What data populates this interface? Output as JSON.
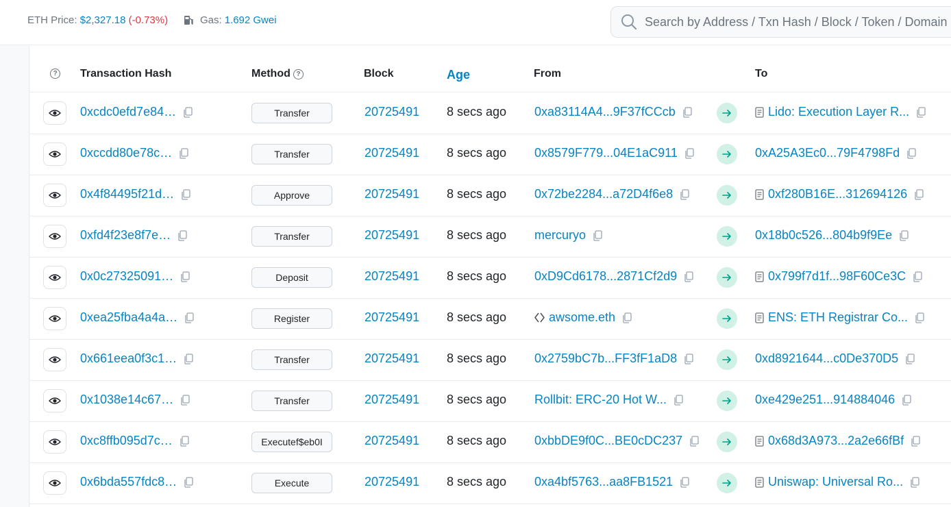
{
  "topbar": {
    "eth_price_label": "ETH Price:",
    "eth_price_value": "$2,327.18",
    "eth_price_change": "(-0.73%)",
    "gas_label": "Gas:",
    "gas_value": "1.692 Gwei",
    "search_placeholder": "Search by Address / Txn Hash / Block / Token / Domain Name"
  },
  "table": {
    "headers": {
      "txhash": "Transaction Hash",
      "method": "Method",
      "block": "Block",
      "age": "Age",
      "from": "From",
      "to": "To"
    },
    "rows": [
      {
        "hash": "0xcdc0efd7e84…",
        "method": "Transfer",
        "block": "20725491",
        "age": "8 secs ago",
        "from": "0xa83114A4...9F37fCCcb",
        "from_icon": "",
        "to": "Lido: Execution Layer R...",
        "to_icon": "contract"
      },
      {
        "hash": "0xccdd80e78c…",
        "method": "Transfer",
        "block": "20725491",
        "age": "8 secs ago",
        "from": "0x8579F779...04E1aC911",
        "from_icon": "",
        "to": "0xA25A3Ec0...79F4798Fd",
        "to_icon": ""
      },
      {
        "hash": "0x4f84495f21d…",
        "method": "Approve",
        "block": "20725491",
        "age": "8 secs ago",
        "from": "0x72be2284...a72D4f6e8",
        "from_icon": "",
        "to": "0xf280B16E...312694126",
        "to_icon": "contract"
      },
      {
        "hash": "0xfd4f23e8f7e…",
        "method": "Transfer",
        "block": "20725491",
        "age": "8 secs ago",
        "from": "mercuryo",
        "from_icon": "",
        "to": "0x18b0c526...804b9f9Ee",
        "to_icon": ""
      },
      {
        "hash": "0x0c27325091…",
        "method": "Deposit",
        "block": "20725491",
        "age": "8 secs ago",
        "from": "0xD9Cd6178...2871Cf2d9",
        "from_icon": "",
        "to": "0x799f7d1f...98F60Ce3C",
        "to_icon": "contract"
      },
      {
        "hash": "0xea25fba4a4a…",
        "method": "Register",
        "block": "20725491",
        "age": "8 secs ago",
        "from": "awsome.eth",
        "from_icon": "ens",
        "to": "ENS: ETH Registrar Co...",
        "to_icon": "contract"
      },
      {
        "hash": "0x661eea0f3c1…",
        "method": "Transfer",
        "block": "20725491",
        "age": "8 secs ago",
        "from": "0x2759bC7b...FF3fF1aD8",
        "from_icon": "",
        "to": "0xd8921644...c0De370D5",
        "to_icon": ""
      },
      {
        "hash": "0x1038e14c67…",
        "method": "Transfer",
        "block": "20725491",
        "age": "8 secs ago",
        "from": "Rollbit: ERC-20 Hot W...",
        "from_icon": "",
        "to": "0xe429e251...914884046",
        "to_icon": ""
      },
      {
        "hash": "0xc8ffb095d7c…",
        "method": "Executef$eb0I",
        "block": "20725491",
        "age": "8 secs ago",
        "from": "0xbbDE9f0C...BE0cDC237",
        "from_icon": "",
        "to": "0x68d3A973...2a2e66fBf",
        "to_icon": "contract"
      },
      {
        "hash": "0x6bda557fdc8…",
        "method": "Execute",
        "block": "20725491",
        "age": "8 secs ago",
        "from": "0xa4bf5763...aa8FB1521",
        "from_icon": "",
        "to": "Uniswap: Universal Ro...",
        "to_icon": "contract"
      }
    ]
  },
  "colors": {
    "link": "#0784c3",
    "negative": "#dc3545",
    "arrow_bg": "#d1f0e6",
    "arrow": "#00a186"
  }
}
